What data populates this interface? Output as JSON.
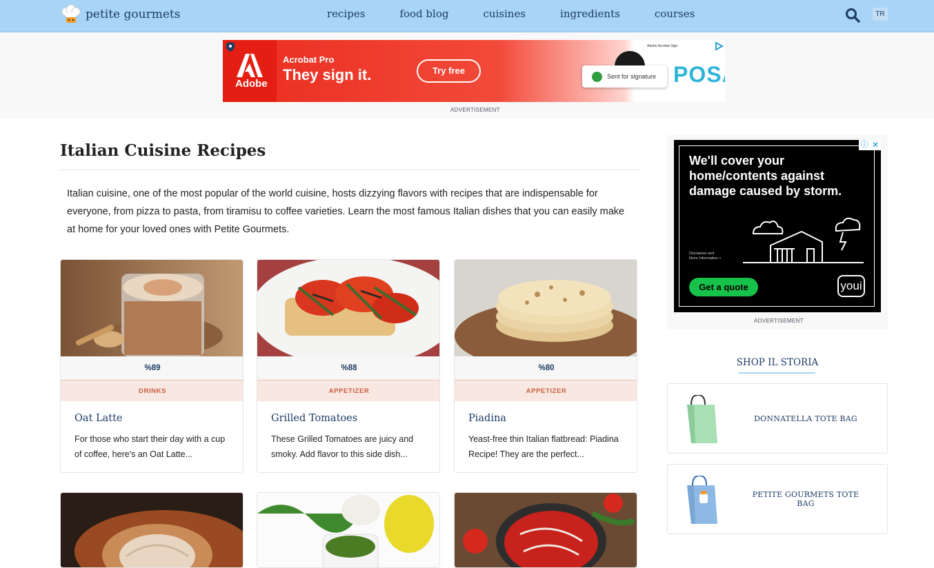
{
  "site": {
    "name": "petite gourmets",
    "lang": "TR"
  },
  "nav": {
    "items": [
      "recipes",
      "food blog",
      "cuisines",
      "ingredients",
      "courses"
    ]
  },
  "top_ad": {
    "brand": "Adobe",
    "product": "Acrobat Pro",
    "headline": "They sign it.",
    "cta": "Try free",
    "toast": "Sent for signature",
    "sign_label": "Adobe Acrobat Sign",
    "partial_word": "POSA",
    "label": "ADVERTISEMENT"
  },
  "page": {
    "title": "Italian Cuisine Recipes",
    "intro": "Italian cuisine, one of the most popular of the world cuisine, hosts dizzying flavors with recipes that are indispensable for everyone, from pizza to pasta, from tiramisu to coffee varieties. Learn the most famous Italian dishes that you can easily make at home for your loved ones with Petite Gourmets."
  },
  "recipes": [
    {
      "score": "%89",
      "category": "DRINKS",
      "name": "Oat Latte",
      "desc": "For those who start their day with a cup of coffee, here's an Oat Latte..."
    },
    {
      "score": "%88",
      "category": "APPETIZER",
      "name": "Grilled Tomatoes",
      "desc": "These Grilled Tomatoes are juicy and smoky. Add flavor to this side dish..."
    },
    {
      "score": "%80",
      "category": "APPETIZER",
      "name": "Piadina",
      "desc": "Yeast-free thin Italian flatbread: Piadina Recipe! They are the perfect..."
    }
  ],
  "side_ad": {
    "headline": "We'll cover your home/contents against damage caused by storm.",
    "disclaimer_1": "Disclaimer and",
    "disclaimer_2": "More Information >",
    "cta": "Get a quote",
    "brand": "youi",
    "label": "ADVERTISEMENT"
  },
  "shop": {
    "title": "SHOP IL STORIA",
    "items": [
      {
        "name": "DONNATELLA TOTE BAG"
      },
      {
        "name": "PETITE GOURMETS TOTE BAG"
      }
    ]
  },
  "colors": {
    "header": "#a8d4f5",
    "brand_navy": "#1d3c66",
    "category": "#c65e3e",
    "ad_red": "#ea2c1e",
    "ad_green": "#17c24b"
  }
}
